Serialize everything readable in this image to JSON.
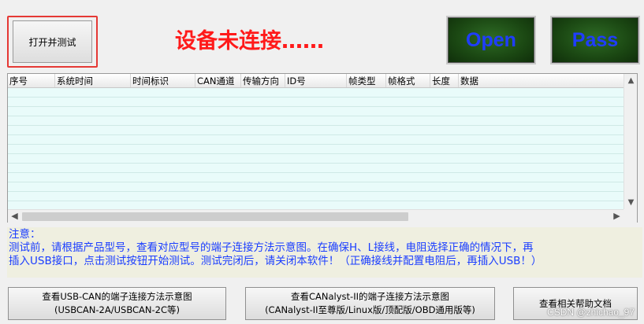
{
  "toolbar": {
    "open_test_label": "打开并测试",
    "status_text": "设备未连接……",
    "open_label": "Open",
    "pass_label": "Pass"
  },
  "colors": {
    "status_red": "#ff1a1a",
    "notice_blue": "#1a3dff",
    "grid_body": "#e9fbfa",
    "lamp_green": "#1a4612"
  },
  "grid": {
    "columns": [
      "序号",
      "系统时间",
      "时间标识",
      "CAN通道",
      "传输方向",
      "ID号",
      "帧类型",
      "帧格式",
      "长度",
      "数据"
    ],
    "rows": []
  },
  "notice": {
    "title": "注意：",
    "line1": "测试前，请根据产品型号，查看对应型号的端子连接方法示意图。在确保H、L接线，电阻选择正确的情况下，再",
    "line2": "插入USB接口，点击测试按钮开始测试。测试完闭后，请关闭本软件！（正确接线并配置电阻后，再插入USB！）"
  },
  "bottom": {
    "usbcan_line1": "查看USB-CAN的端子连接方法示意图",
    "usbcan_line2": "(USBCAN-2A/USBCAN-2C等)",
    "canalyst_line1": "查看CANalyst-II的端子连接方法示意图",
    "canalyst_line2": "(CANalyst-II至尊版/Linux版/顶配版/OBD通用版等)",
    "help_label": "查看相关帮助文档"
  },
  "icons": {
    "scroll_up": "▲",
    "scroll_down": "▼",
    "scroll_left": "◀",
    "scroll_right": "▶"
  },
  "watermark": "CSDN @zhichao_97"
}
